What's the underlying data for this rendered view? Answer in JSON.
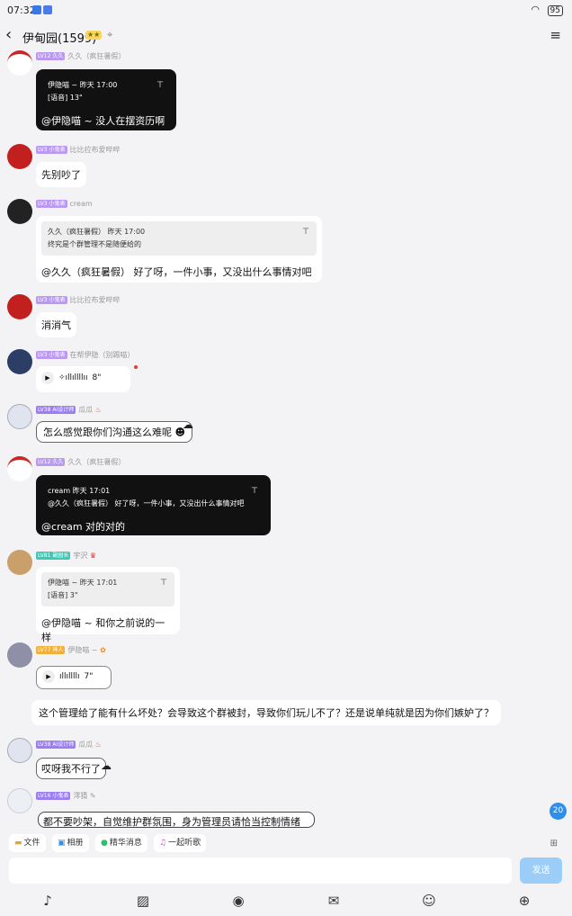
{
  "status_bar": {
    "time": "07:32",
    "battery": "95"
  },
  "header": {
    "back": "‹",
    "title": "伊甸园(1599)",
    "menu": "≡"
  },
  "messages": [
    {
      "level": "LV12 久久",
      "name": "久久（疯狂暑假）",
      "quote_head": "伊隐喵 ~ 昨天 17:00",
      "quote_body": "[语音] 13\"",
      "reply": "@伊隐喵 ~ 没人在摆资历啊"
    },
    {
      "level": "LV3 小鬼表",
      "name": "比比拉布爱哔哔",
      "text": "先别吵了"
    },
    {
      "level": "LV3 小鬼表",
      "name": "cream",
      "quote_head": "久久（疯狂暑假） 昨天 17:00",
      "quote_body": "终究是个群管理不是随便给的",
      "reply": "@久久（疯狂暑假） 好了呀，一件小事，又没出什么事情对吧"
    },
    {
      "level": "LV3 小鬼表",
      "name": "比比拉布爱哔哔",
      "text": "消消气"
    },
    {
      "level": "LV3 小鬼表",
      "name": "在帮伊隐（别踢喵）",
      "voice": "8\""
    },
    {
      "level": "LV38 AI设计师",
      "name": "瓜瓜",
      "text": "怎么感觉跟你们沟通这么难呢"
    },
    {
      "level": "LV12 久久",
      "name": "久久（疯狂暑假）",
      "quote_head": "cream 昨天 17:01",
      "quote_body": "@久久（疯狂暑假） 好了呀，一件小事，又没出什么事情对吧",
      "reply": "@cream 对的对的"
    },
    {
      "level": "LV81 副园长",
      "name": "宇沢",
      "quote_head": "伊隐喵 ~ 昨天 17:01",
      "quote_body": "[语音] 3\"",
      "reply": "@伊隐喵 ~ 和你之前说的一样"
    },
    {
      "level": "LV77 神人",
      "name": "伊隐喵 ~",
      "voice": "7\"",
      "text": "这个管理给了能有什么坏处？会导致这个群被封，导致你们玩儿不了？还是说单纯就是因为你们嫉妒了？"
    },
    {
      "level": "LV38 AI设计师",
      "name": "瓜瓜",
      "text": "哎呀我不行了"
    },
    {
      "level": "LV16 小鬼表",
      "name": "澪猜",
      "text": "都不要吵架，自觉维护群氛围，身为管理员请恰当控制情绪"
    }
  ],
  "unread_count": "20",
  "shortcuts": [
    "文件",
    "相册",
    "精华消息",
    "一起听歌"
  ],
  "send_label": "发送",
  "toolbar_icons": [
    "mic-icon",
    "image-icon",
    "camera-icon",
    "red-packet-icon",
    "emoji-icon",
    "plus-icon"
  ],
  "colors": {
    "send_button": "#9ccdf8",
    "unread_badge": "#2f8ee8",
    "level_badge": "#b99af0"
  }
}
